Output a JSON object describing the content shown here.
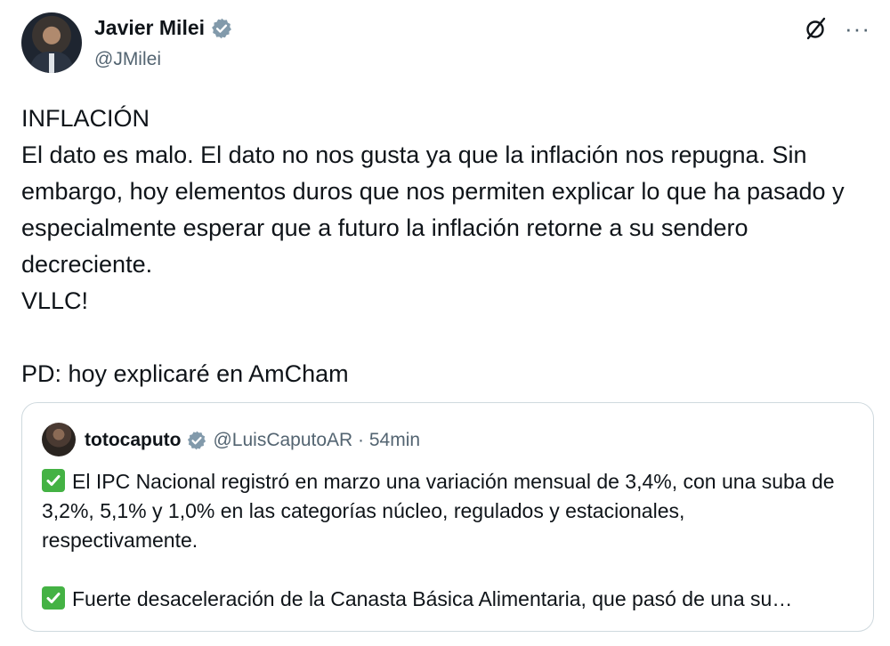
{
  "author": {
    "display_name": "Javier Milei",
    "handle": "@JMilei"
  },
  "tweet": {
    "lines": [
      "INFLACIÓN",
      "El dato es malo. El dato no nos gusta ya que la inflación nos repugna. Sin embargo, hoy elementos duros que nos permiten explicar lo que ha pasado y especialmente esperar que a futuro la inflación retorne a su sendero decreciente.",
      "VLLC!",
      "PD: hoy explicaré en AmCham"
    ]
  },
  "top_actions": {
    "more": "···"
  },
  "quote": {
    "display_name": "totocaputo",
    "handle_time": "@LuisCaputoAR · 54min",
    "paragraph1": "El IPC Nacional registró en marzo una variación mensual de 3,4%, con una suba de 3,2%, 5,1% y 1,0% en las categorías núcleo, regulados y estacionales, respectivamente.",
    "paragraph2": "Fuerte desaceleración de la Canasta Básica Alimentaria, que pasó de una su…"
  },
  "colors": {
    "verified": "#829aab",
    "check_green": "#44b244",
    "secondary_text": "#536471",
    "border": "#cfd9de"
  },
  "icons": [
    "verified-badge-icon",
    "grok-icon",
    "more-options-icon",
    "check-mark-icon"
  ]
}
